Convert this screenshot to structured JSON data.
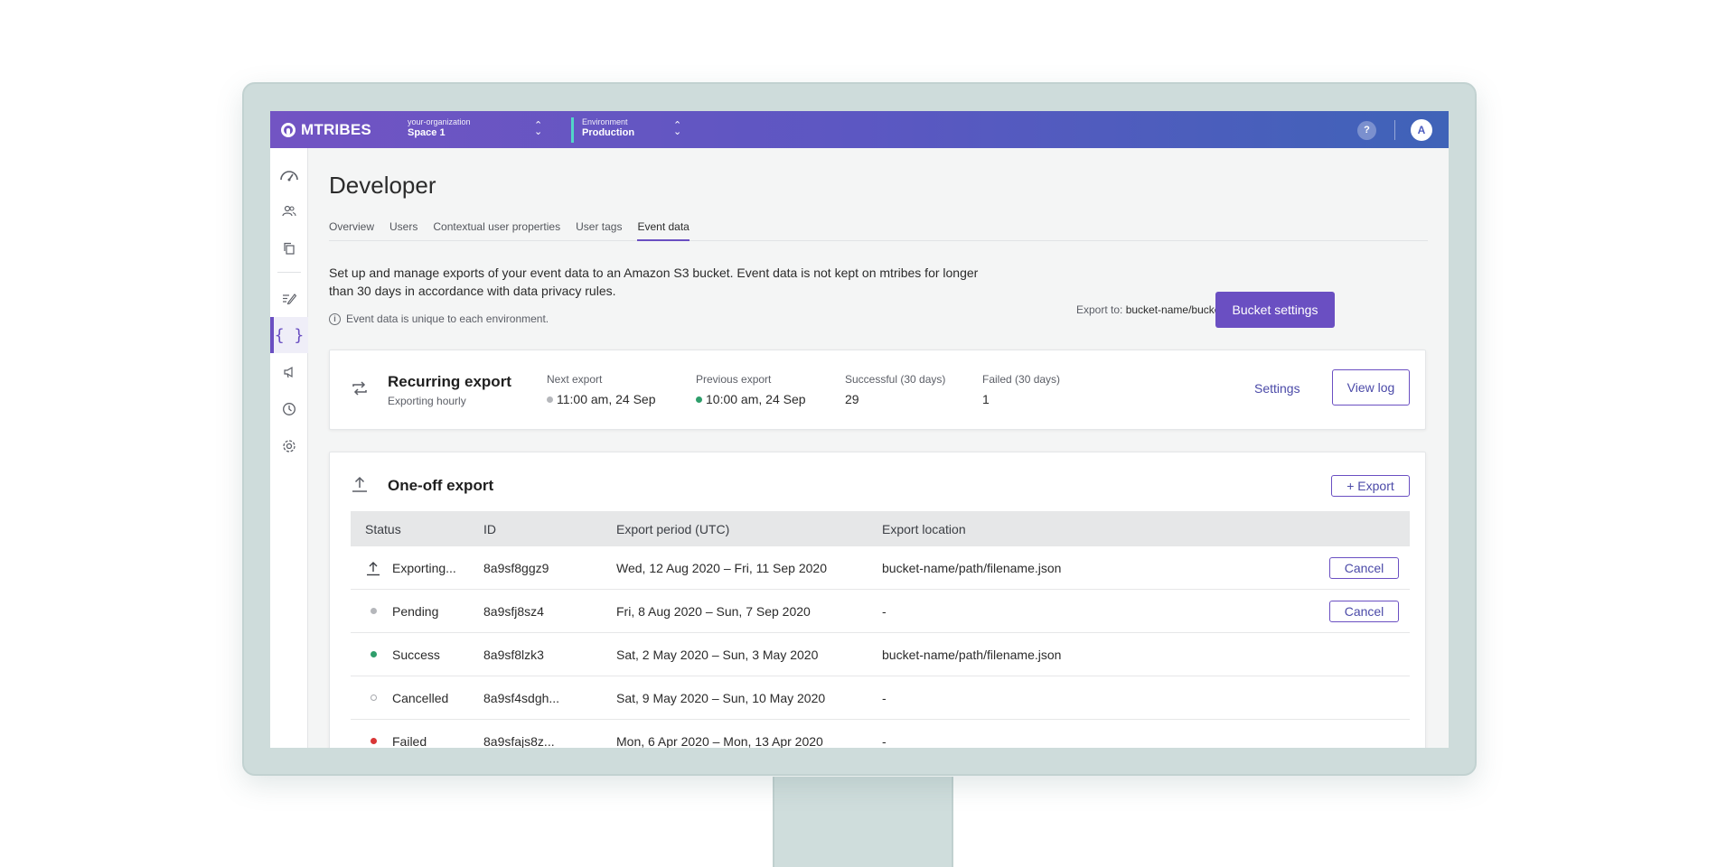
{
  "app": {
    "logo_text": "MTRIBES",
    "org_label": "your-organization",
    "space_value": "Space 1",
    "env_label": "Environment",
    "env_value": "Production",
    "help_label": "?",
    "avatar_initial": "A",
    "colors": {
      "brand": "#6a4fc2",
      "env_accent": "#52d6c8",
      "success": "#2e9e6b",
      "failed": "#d93636",
      "pending": "#b5b7bb"
    }
  },
  "sidebar": {
    "items": [
      {
        "icon": "dashboard-icon",
        "active": false
      },
      {
        "icon": "users-icon",
        "active": false
      },
      {
        "icon": "copy-icon",
        "active": false
      },
      {
        "icon": "edit-icon",
        "active": false
      },
      {
        "icon": "code-braces-icon",
        "active": true
      },
      {
        "icon": "megaphone-icon",
        "active": false
      },
      {
        "icon": "history-icon",
        "active": false
      },
      {
        "icon": "settings-icon",
        "active": false
      }
    ]
  },
  "page": {
    "title": "Developer",
    "tabs": [
      "Overview",
      "Users",
      "Contextual user properties",
      "User tags",
      "Event data"
    ],
    "active_tab": "Event data",
    "intro": "Set up and manage exports of your event data to an Amazon S3 bucket. Event data is not kept on mtribes for longer than 30 days in accordance with data privacy rules.",
    "note": "Event data is unique to each environment.",
    "export_to_label": "Export to:",
    "export_to_value": "bucket-name/bucket-path",
    "bucket_settings_label": "Bucket settings"
  },
  "recurring": {
    "title": "Recurring export",
    "subtitle": "Exporting hourly",
    "next_label": "Next export",
    "next_value": "11:00 am, 24 Sep",
    "prev_label": "Previous export",
    "prev_value": "10:00 am, 24 Sep",
    "success_label": "Successful (30 days)",
    "success_value": "29",
    "failed_label": "Failed (30 days)",
    "failed_value": "1",
    "settings_label": "Settings",
    "view_log_label": "View log"
  },
  "oneoff": {
    "title": "One-off export",
    "export_button": "+ Export",
    "columns": [
      "Status",
      "ID",
      "Export period (UTC)",
      "Export location"
    ],
    "cancel_label": "Cancel",
    "rows": [
      {
        "status": "Exporting...",
        "status_type": "exporting",
        "id": "8a9sf8ggz9",
        "period": "Wed, 12 Aug 2020 – Fri, 11 Sep 2020",
        "location": "bucket-name/path/filename.json",
        "cancellable": true
      },
      {
        "status": "Pending",
        "status_type": "pending",
        "id": "8a9sfj8sz4",
        "period": "Fri, 8 Aug 2020 – Sun, 7 Sep 2020",
        "location": "-",
        "cancellable": true
      },
      {
        "status": "Success",
        "status_type": "success",
        "id": "8a9sf8lzk3",
        "period": "Sat, 2 May 2020 – Sun, 3 May 2020",
        "location": "bucket-name/path/filename.json",
        "cancellable": false
      },
      {
        "status": "Cancelled",
        "status_type": "cancelled",
        "id": "8a9sf4sdgh...",
        "period": "Sat, 9 May 2020 – Sun, 10 May 2020",
        "location": "-",
        "cancellable": false
      },
      {
        "status": "Failed",
        "status_type": "failed",
        "id": "8a9sfajs8z...",
        "period": "Mon, 6 Apr 2020 – Mon, 13 Apr 2020",
        "location": "-",
        "cancellable": false
      }
    ]
  }
}
